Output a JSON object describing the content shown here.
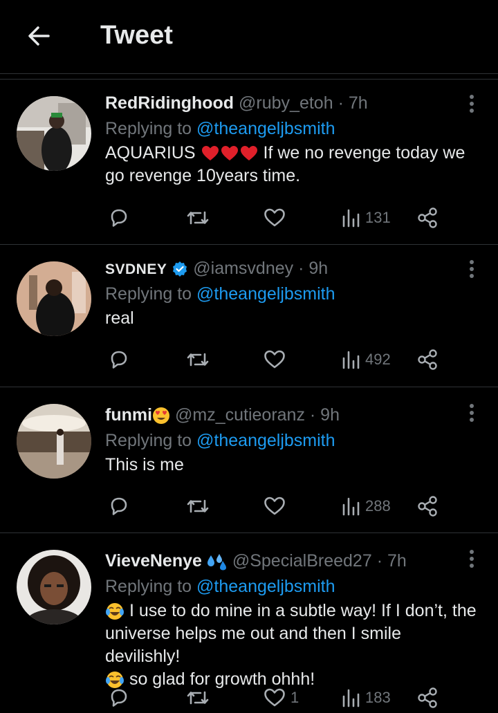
{
  "header": {
    "title": "Tweet"
  },
  "tweets": [
    {
      "name": "RedRidinghood",
      "handle": "@ruby_etoh",
      "time": "· 7h",
      "replying_prefix": "Replying to",
      "replying_to": "@theangeljbsmith",
      "text_a": "AQUARIUS",
      "text_b": "If we no revenge today we go revenge 10years time.",
      "likes": "",
      "views": "131"
    },
    {
      "name": "SVDNEY",
      "handle": "@iamsvdney",
      "time": "· 9h",
      "replying_prefix": "Replying to",
      "replying_to": "@theangeljbsmith",
      "text": "real",
      "likes": "",
      "views": "492",
      "verified": true
    },
    {
      "name": "funmi",
      "handle": "@mz_cutieoranz",
      "time": "· 9h",
      "replying_prefix": "Replying to",
      "replying_to": "@theangeljbsmith",
      "text": "This is me",
      "likes": "",
      "views": "288"
    },
    {
      "name": "VieveNenye",
      "handle": "@SpecialBreed27",
      "time": "· 7h",
      "replying_prefix": "Replying to",
      "replying_to": "@theangeljbsmith",
      "text_a": "I use to do mine in a subtle way! If I don’t, the universe helps me out and then I smile devilishly!",
      "text_b": "so glad for growth ohhh!",
      "likes": "1",
      "views": "183"
    }
  ],
  "icons": [
    "back-arrow-icon",
    "more-icon",
    "reply-icon",
    "retweet-icon",
    "like-icon",
    "views-icon",
    "share-icon",
    "red-heart-icon",
    "verified-badge-icon",
    "heart-eyes-emoji-icon",
    "sweat-droplets-emoji-icon",
    "laughing-tears-emoji-icon"
  ],
  "colors": {
    "background": "#000000",
    "accent": "#1d9bf0",
    "muted": "#71767b",
    "text": "#e7e9ea",
    "divider": "#2f3336"
  }
}
